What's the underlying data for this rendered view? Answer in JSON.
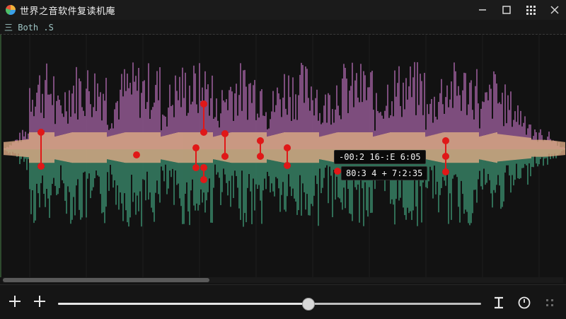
{
  "window": {
    "title": "世界之音软件复读机庵",
    "controls": [
      "minimize-icon",
      "maximize-icon",
      "grid-icon",
      "close-icon"
    ]
  },
  "toolbar": {
    "view_label": "三 Both .S"
  },
  "waveform": {
    "colors": {
      "upper": "#b06ab0",
      "lower": "#3e9a78",
      "center": "#e9b48c",
      "marker": "#e01818"
    }
  },
  "tooltips": {
    "time_range": "-00:2 16-:E 6:05",
    "position": "80:3 4 + 7:2:35"
  },
  "playback": {
    "progress": 0.59
  },
  "bottom_toolbar": {
    "buttons": [
      "add-icon",
      "add-icon",
      "text-cursor-icon",
      "clock-icon",
      "drag-grip-icon"
    ]
  }
}
